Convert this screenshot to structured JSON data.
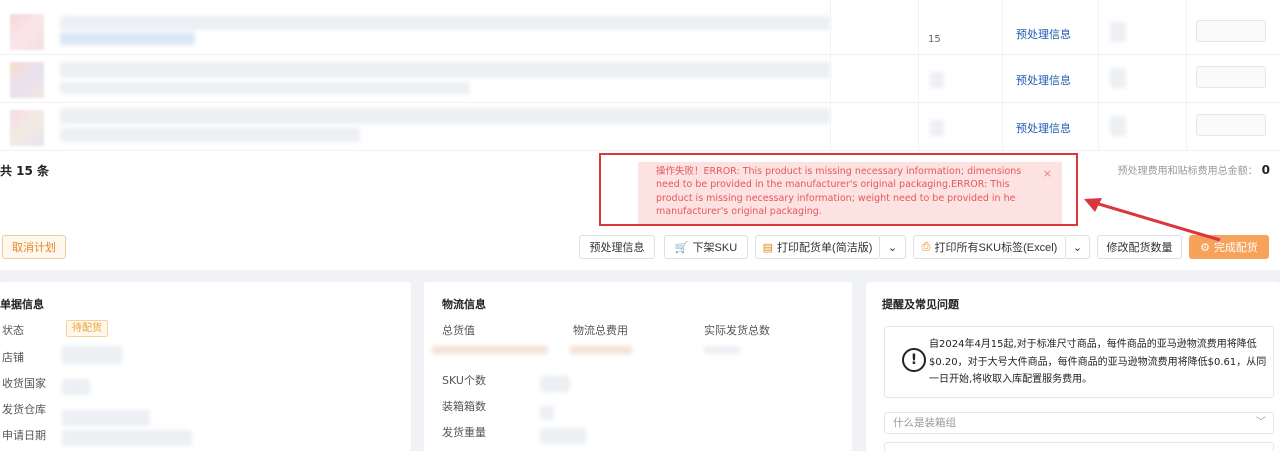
{
  "table": {
    "rows": [
      {
        "count": "15",
        "link": "预处理信息"
      },
      {
        "count": "",
        "link": "预处理信息"
      },
      {
        "count": "",
        "link": "预处理信息"
      }
    ],
    "total": "共 15 条",
    "fee_label": "预处理费用和贴标费用总金额：",
    "fee_value": "0"
  },
  "error_toast": {
    "message": "操作失败！ERROR: This product is missing necessary information; dimensions need to be provided in the manufacturer's original packaging.ERROR: This product is missing necessary information; weight need to be provided in he manufacturer's original packaging.",
    "close": "×"
  },
  "actions": {
    "cancel": "取消计划",
    "preprocess": "预处理信息",
    "delist": "下架SKU",
    "print_simple": "打印配货单(简洁版)",
    "print_all": "打印所有SKU标签(Excel)",
    "modify": "修改配货数量",
    "complete": "完成配货",
    "dropdown": "⌄"
  },
  "doc_info": {
    "title": "单据信息",
    "fields": [
      "状态",
      "店铺",
      "收货国家",
      "发货仓库",
      "申请日期"
    ],
    "status_value": "待配货"
  },
  "logistics": {
    "title": "物流信息",
    "headers": [
      "总货值",
      "物流总费用",
      "实际发货总数"
    ],
    "fields": [
      "SKU个数",
      "装箱箱数",
      "发货重量"
    ]
  },
  "tips": {
    "title": "提醒及常见问题",
    "notice": "自2024年4月15起,对于标准尺寸商品，每件商品的亚马逊物流费用将降低$0.20，对于大号大件商品，每件商品的亚马逊物流费用将降低$0.61，从同一日开始,将收取入库配置服务费用。",
    "faq1": "什么是装箱组"
  },
  "colors": {
    "accent": "#f7a25a",
    "error": "#d9363e",
    "link": "#1f5bb3"
  }
}
